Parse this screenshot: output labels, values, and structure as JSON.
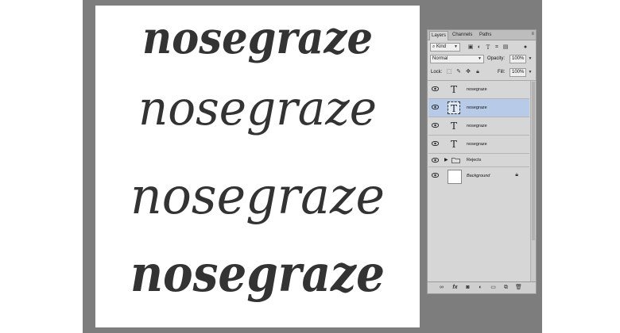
{
  "canvas": {
    "words": [
      "nosegraze",
      "nosegraze",
      "nosegraze",
      "nosegraze"
    ]
  },
  "panel": {
    "tabs": [
      "Layers",
      "Channels",
      "Paths"
    ],
    "filter": {
      "kind_label": "Kind"
    },
    "blend_mode": "Normal",
    "opacity_label": "Opacity:",
    "opacity_value": "100%",
    "lock_label": "Lock:",
    "fill_label": "Fill:",
    "fill_value": "100%",
    "layers": [
      {
        "name": "nosegraze",
        "type": "text",
        "selected": false
      },
      {
        "name": "nosegraze",
        "type": "text",
        "selected": true
      },
      {
        "name": "nosegraze",
        "type": "text",
        "selected": false
      },
      {
        "name": "nosegraze",
        "type": "text",
        "selected": false
      },
      {
        "name": "Rejects",
        "type": "group",
        "selected": false
      },
      {
        "name": "Background",
        "type": "background",
        "selected": false
      }
    ],
    "footer_icons": [
      "link-icon",
      "fx-icon",
      "mask-icon",
      "adjustment-icon",
      "folder-icon",
      "new-layer-icon",
      "trash-icon"
    ]
  },
  "colors": {
    "workspace": "#7d7d7d",
    "ink": "#333333",
    "selection": "#b7cbe8"
  }
}
